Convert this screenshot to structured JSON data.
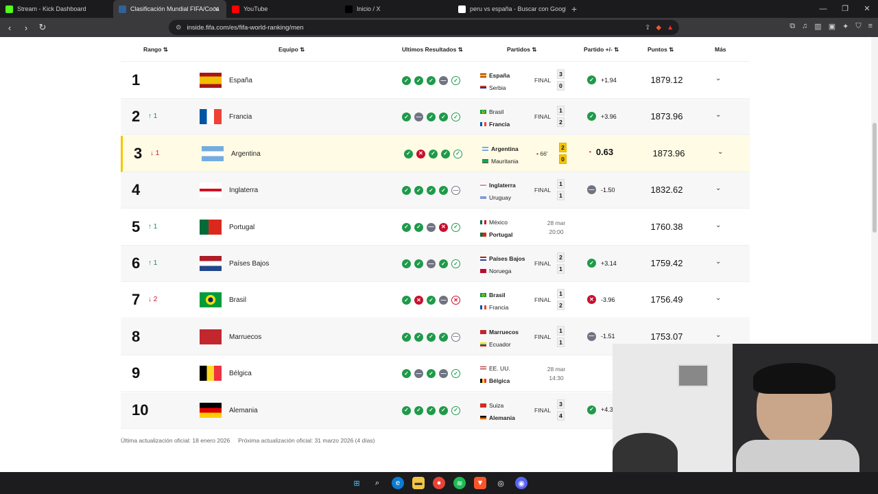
{
  "browser": {
    "tabs": [
      {
        "label": "Stream - Kick Dashboard",
        "icon": "kick-icon",
        "color": "#53fc18"
      },
      {
        "label": "Clasificación Mundial FIFA/Coca",
        "icon": "fifa-icon",
        "color": "#326295",
        "active": true
      },
      {
        "label": "YouTube",
        "icon": "youtube-icon",
        "color": "#ff0000"
      },
      {
        "label": "Inicio / X",
        "icon": "x-icon",
        "color": "#000000"
      },
      {
        "label": "peru vs españa - Buscar con Google",
        "icon": "google-icon",
        "color": "#ffffff"
      }
    ],
    "url": "inside.fifa.com/es/fifa-world-ranking/men"
  },
  "table": {
    "headers": {
      "rank": "Rango",
      "team": "Equipo",
      "form": "Ultimos Resultados",
      "matches": "Partidos",
      "delta": "Partido +/-",
      "points": "Puntos",
      "more": "Más"
    },
    "rows": [
      {
        "rank": "1",
        "move": "",
        "dir": "",
        "team": "España",
        "flag": "es",
        "form": [
          "w",
          "w",
          "w",
          "d",
          "lastw"
        ],
        "m1": "España",
        "m1b": true,
        "m1f": "es",
        "m2": "Serbia",
        "m2b": false,
        "m2f": "rs",
        "status": "FINAL",
        "s1": "3",
        "s2": "0",
        "live": false,
        "delta": "+1.94",
        "dtype": "w",
        "points": "1879.12"
      },
      {
        "rank": "2",
        "move": "1",
        "dir": "up",
        "team": "Francia",
        "flag": "fr",
        "form": [
          "w",
          "d",
          "w",
          "w",
          "lastw"
        ],
        "m1": "Brasil",
        "m1b": false,
        "m1f": "br",
        "m2": "Francia",
        "m2b": true,
        "m2f": "fr",
        "status": "FINAL",
        "s1": "1",
        "s2": "2",
        "live": false,
        "delta": "+3.96",
        "dtype": "w",
        "points": "1873.96"
      },
      {
        "rank": "3",
        "move": "1",
        "dir": "down",
        "team": "Argentina",
        "flag": "ar",
        "form": [
          "w",
          "l",
          "w",
          "w",
          "lastw"
        ],
        "m1": "Argentina",
        "m1b": true,
        "m1f": "ar",
        "m2": "Mauritania",
        "m2b": false,
        "m2f": "mr",
        "status": "66'",
        "s1": "2",
        "s2": "0",
        "live": true,
        "delta": "0.63",
        "dtype": "live",
        "points": "1873.96"
      },
      {
        "rank": "4",
        "move": "",
        "dir": "",
        "team": "Inglaterra",
        "flag": "en",
        "form": [
          "w",
          "w",
          "w",
          "w",
          "lastd"
        ],
        "m1": "Inglaterra",
        "m1b": true,
        "m1f": "en",
        "m2": "Uruguay",
        "m2b": false,
        "m2f": "uy",
        "status": "FINAL",
        "s1": "1",
        "s2": "1",
        "live": false,
        "delta": "-1.50",
        "dtype": "d",
        "points": "1832.62"
      },
      {
        "rank": "5",
        "move": "1",
        "dir": "up",
        "team": "Portugal",
        "flag": "pt",
        "form": [
          "w",
          "w",
          "d",
          "l",
          "lastw"
        ],
        "m1": "México",
        "m1b": false,
        "m1f": "mx",
        "m2": "Portugal",
        "m2b": true,
        "m2f": "pt",
        "status": "28 mar\n20:00",
        "s1": "",
        "s2": "",
        "live": false,
        "delta": "",
        "dtype": "",
        "points": "1760.38"
      },
      {
        "rank": "6",
        "move": "1",
        "dir": "up",
        "team": "Países Bajos",
        "flag": "nl",
        "form": [
          "w",
          "w",
          "d",
          "w",
          "lastw"
        ],
        "m1": "Países Bajos",
        "m1b": true,
        "m1f": "nl",
        "m2": "Noruega",
        "m2b": false,
        "m2f": "no",
        "status": "FINAL",
        "s1": "2",
        "s2": "1",
        "live": false,
        "delta": "+3.14",
        "dtype": "w",
        "points": "1759.42"
      },
      {
        "rank": "7",
        "move": "2",
        "dir": "down",
        "team": "Brasil",
        "flag": "br",
        "form": [
          "w",
          "l",
          "w",
          "d",
          "lastl"
        ],
        "m1": "Brasil",
        "m1b": true,
        "m1f": "br",
        "m2": "Francia",
        "m2b": false,
        "m2f": "fr",
        "status": "FINAL",
        "s1": "1",
        "s2": "2",
        "live": false,
        "delta": "-3.96",
        "dtype": "l",
        "points": "1756.49"
      },
      {
        "rank": "8",
        "move": "",
        "dir": "",
        "team": "Marruecos",
        "flag": "ma",
        "form": [
          "w",
          "w",
          "w",
          "w",
          "lastd"
        ],
        "m1": "Marruecos",
        "m1b": true,
        "m1f": "ma",
        "m2": "Ecuador",
        "m2b": false,
        "m2f": "ec",
        "status": "FINAL",
        "s1": "1",
        "s2": "1",
        "live": false,
        "delta": "-1.51",
        "dtype": "d",
        "points": "1753.07"
      },
      {
        "rank": "9",
        "move": "",
        "dir": "",
        "team": "Bélgica",
        "flag": "be",
        "form": [
          "w",
          "d",
          "w",
          "d",
          "lastw"
        ],
        "m1": "EE. UU.",
        "m1b": false,
        "m1f": "us",
        "m2": "Bélgica",
        "m2b": true,
        "m2f": "be",
        "status": "28 mar\n14:30",
        "s1": "",
        "s2": "",
        "live": false,
        "delta": "",
        "dtype": "",
        "points": ""
      },
      {
        "rank": "10",
        "move": "",
        "dir": "",
        "team": "Alemania",
        "flag": "de",
        "form": [
          "w",
          "w",
          "w",
          "w",
          "lastw"
        ],
        "m1": "Suiza",
        "m1b": false,
        "m1f": "ch",
        "m2": "Alemania",
        "m2b": true,
        "m2f": "de",
        "status": "FINAL",
        "s1": "3",
        "s2": "4",
        "live": false,
        "delta": "+4.3",
        "dtype": "w",
        "points": ""
      }
    ]
  },
  "footer": {
    "last_label": "Última actualización oficial:",
    "last_value": "18 enero 2026",
    "next_label": "Próxima actualización oficial:",
    "next_value": "31 marzo 2026 (4 días)"
  },
  "colors": {
    "win": "#1f9a4a",
    "loss": "#c8102e",
    "draw": "#6f7480",
    "live": "#f5c400"
  }
}
